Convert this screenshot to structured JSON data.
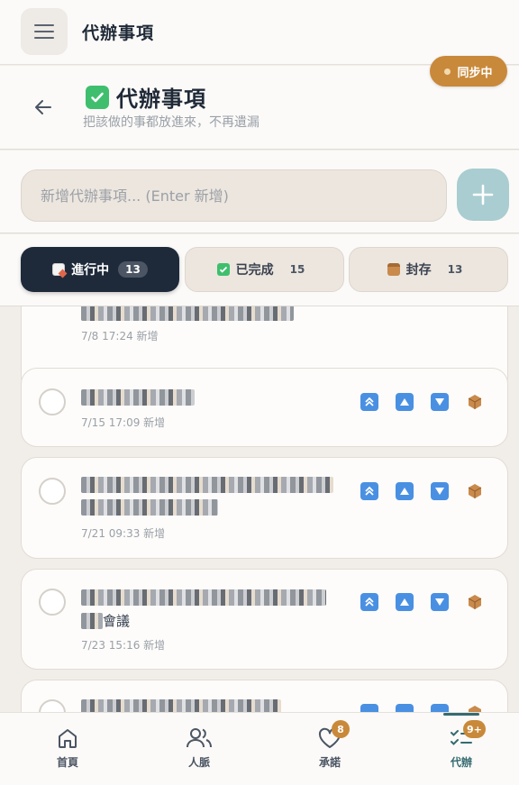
{
  "app": {
    "title": "代辦事項"
  },
  "header": {
    "title": "代辦事項",
    "subtitle": "把該做的事都放進來，不再遺漏",
    "sync_label": "同步中"
  },
  "input": {
    "placeholder": "新增代辦事項... (Enter 新增)"
  },
  "tabs": [
    {
      "label": "進行中",
      "count": "13",
      "active": true
    },
    {
      "label": "已完成",
      "count": "15",
      "active": false
    },
    {
      "label": "封存",
      "count": "13",
      "active": false
    }
  ],
  "todos": [
    {
      "meta": "7/8 17:24 新增"
    },
    {
      "meta": "7/15 17:09 新增"
    },
    {
      "meta": "7/21 09:33 新增"
    },
    {
      "meta": "7/23 15:16 新增",
      "visible_text": "會議"
    },
    {
      "meta": ""
    }
  ],
  "nav": [
    {
      "label": "首頁",
      "icon": "home-icon",
      "badge": ""
    },
    {
      "label": "人脈",
      "icon": "people-icon",
      "badge": ""
    },
    {
      "label": "承諾",
      "icon": "heart-icon",
      "badge": "8"
    },
    {
      "label": "代辦",
      "icon": "checklist-icon",
      "badge": "9+"
    }
  ],
  "colors": {
    "accent": "#c9893a",
    "active_tab": "#1e2a3a",
    "action_blue": "#4a90e2",
    "nav_active": "#356b70"
  }
}
